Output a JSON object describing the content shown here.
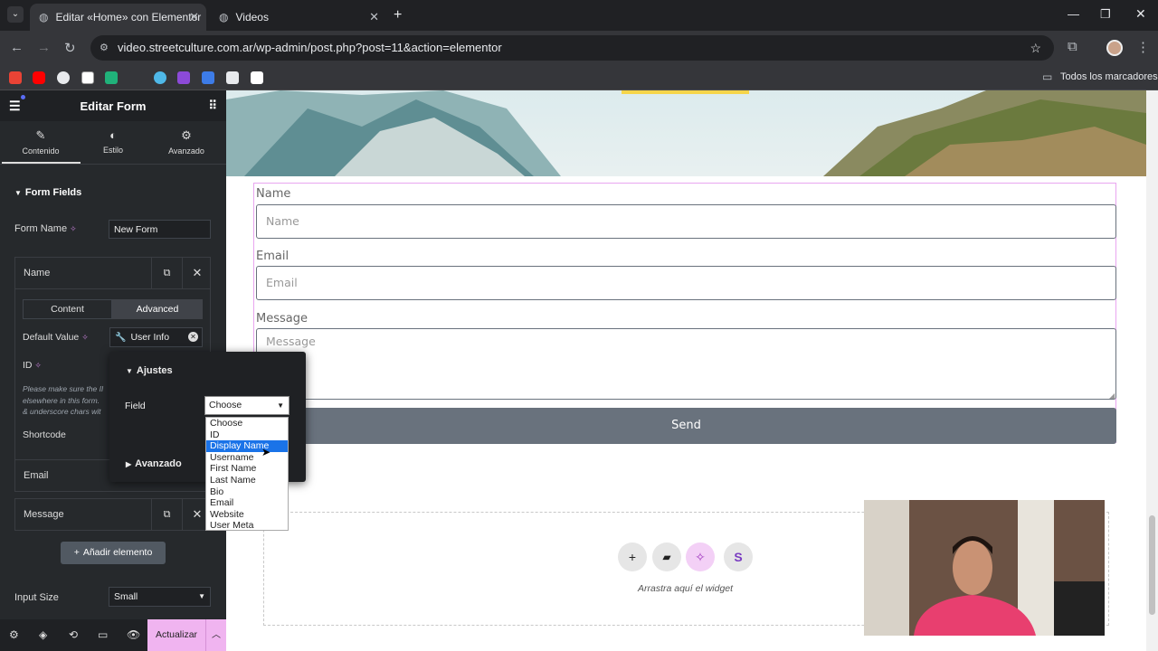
{
  "browser": {
    "tabs": [
      {
        "title": "Editar «Home» con Elementor",
        "active": true
      },
      {
        "title": "Videos",
        "active": false
      }
    ],
    "url": "video.streetculture.com.ar/wp-admin/post.php?post=11&action=elementor",
    "bookmarks_folder": "Todos los marcadores"
  },
  "panel": {
    "title": "Editar Form",
    "tabs": [
      {
        "label": "Contenido",
        "icon": "pencil-icon"
      },
      {
        "label": "Estilo",
        "icon": "half-circle-icon"
      },
      {
        "label": "Avanzado",
        "icon": "gear-icon"
      }
    ],
    "section_title": "Form Fields",
    "form_name_label": "Form Name",
    "form_name_value": "New Form",
    "field_items": [
      "Name",
      "Email",
      "Message"
    ],
    "subtabs": {
      "content": "Content",
      "advanced": "Advanced"
    },
    "default_value_label": "Default Value",
    "default_value_tag": "User Info",
    "id_label": "ID",
    "help_text_1": "Please make sure the II",
    "help_text_2": "elsewhere in this form.",
    "help_text_3": "& underscore chars wit",
    "shortcode_label": "Shortcode",
    "add_item_label": "Añadir elemento",
    "input_size_label": "Input Size",
    "input_size_value": "Small",
    "update_label": "Actualizar"
  },
  "popover": {
    "ajustes_label": "Ajustes",
    "field_label": "Field",
    "selected_value": "Choose",
    "avanzado_label": "Avanzado",
    "options": [
      "Choose",
      "ID",
      "Display Name",
      "Username",
      "First Name",
      "Last Name",
      "Bio",
      "Email",
      "Website",
      "User Meta"
    ],
    "highlighted": "Display Name"
  },
  "form": {
    "fields": [
      {
        "label": "Name",
        "placeholder": "Name"
      },
      {
        "label": "Email",
        "placeholder": "Email"
      },
      {
        "label": "Message",
        "placeholder": "Message"
      }
    ],
    "submit_label": "Send"
  },
  "dropzone": {
    "hint": "Arrastra aquí el widget"
  },
  "colors": {
    "panel_bg": "#26292c",
    "update_pink": "#f0b4f0",
    "button_gray": "#69727d",
    "ai_pink": "#f3d0f6"
  }
}
